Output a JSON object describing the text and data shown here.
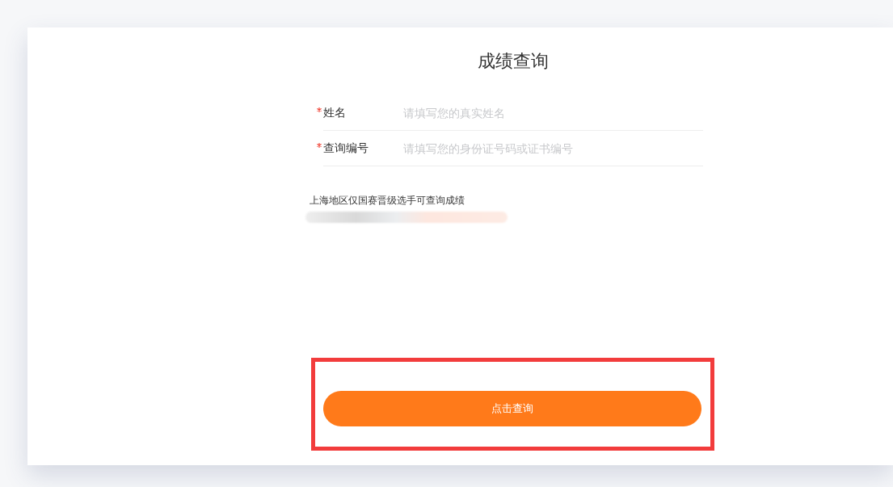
{
  "title": "成绩查询",
  "fields": [
    {
      "label": "姓名",
      "required": true,
      "placeholder": "请填写您的真实姓名"
    },
    {
      "label": "查询编号",
      "required": true,
      "placeholder": "请填写您的身份证号码或证书编号"
    }
  ],
  "notice": "上海地区仅国赛晋级选手可查询成绩",
  "submit_button": {
    "label": "点击查询",
    "highlighted": true
  }
}
